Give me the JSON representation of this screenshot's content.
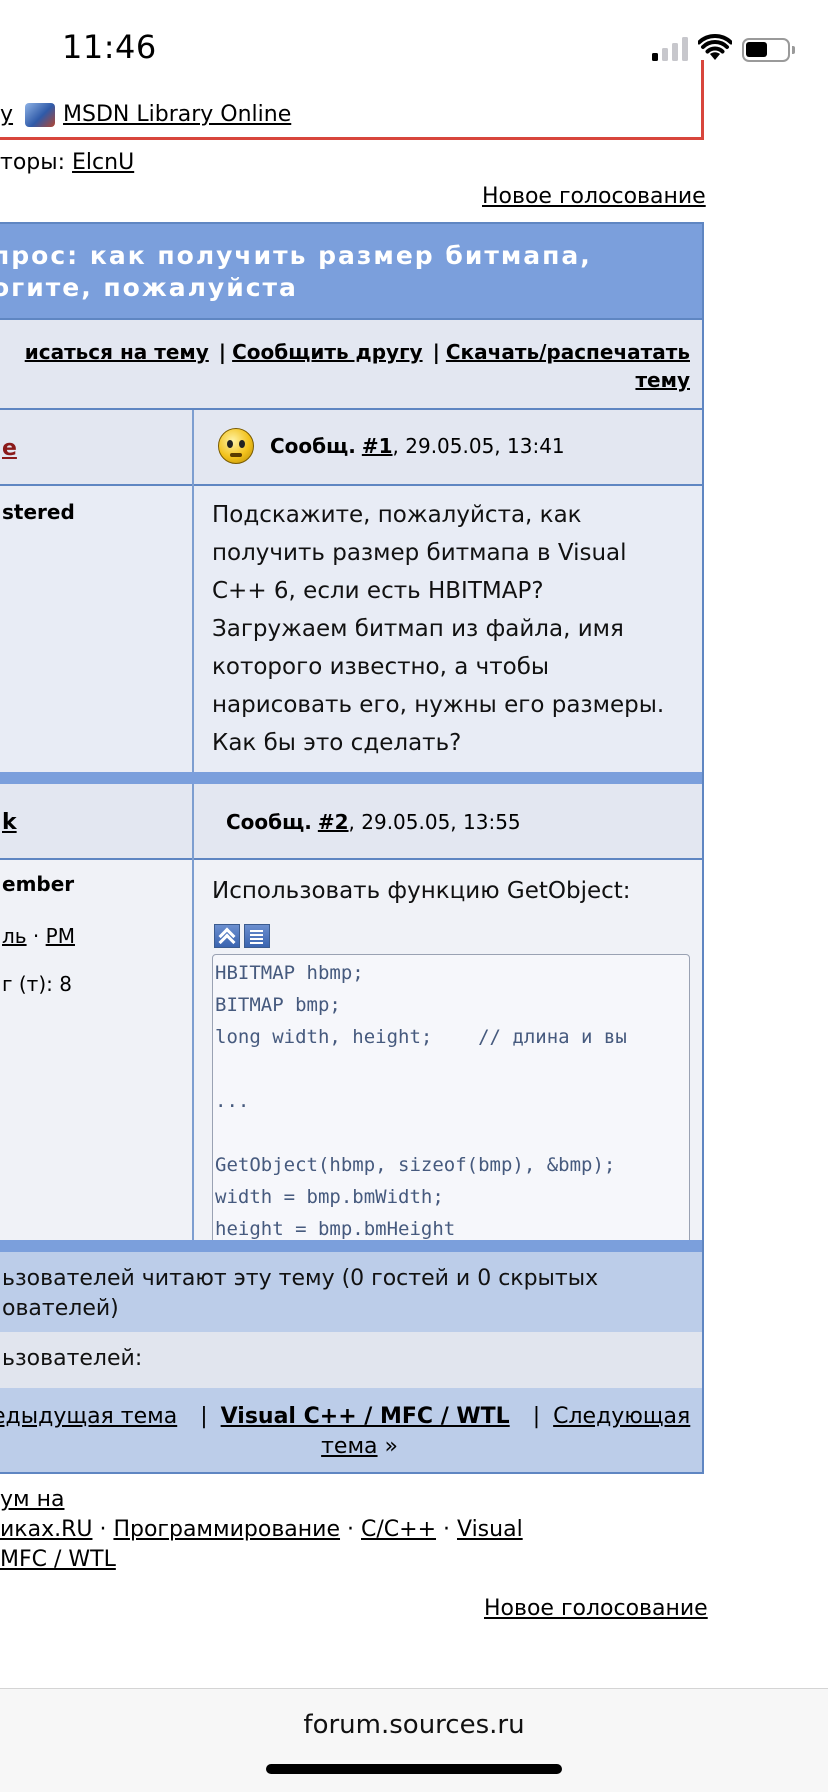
{
  "status_bar": {
    "time": "11:46"
  },
  "top": {
    "msdn_prefix": "у",
    "msdn_link": "MSDN Library Online",
    "moderators_label": "торы:",
    "moderator_name": "ElcnU",
    "new_poll": "Новое голосование"
  },
  "topic": {
    "title_line1": "прос: как получить размер битмапа,",
    "title_line2": "огите, пожалуйста",
    "options": {
      "subscribe": "исаться на тему",
      "tell_friend": "Сообщить другу",
      "download_line1": "Скачать/распечатать",
      "download_line2": "тему"
    }
  },
  "posts": [
    {
      "author": "e",
      "rank": "stered",
      "msg_label": "Сообщ.",
      "msg_num": "#1",
      "msg_date": ", 29.05.05, 13:41",
      "body_lines": [
        "Подскажите, пожалуйста, как",
        "получить размер битмапа в Visual",
        "C++ 6, если есть HBITMAP?",
        "Загружаем битмап из файла, имя",
        "которого известно, а чтобы",
        "нарисовать его, нужны его размеры.",
        "Как бы это сделать?"
      ]
    },
    {
      "author": "k",
      "rank": "ember",
      "profile_link": "ль",
      "pm_link": "PM",
      "reputation": "г (т): 8",
      "msg_label": "Сообщ.",
      "msg_num": "#2",
      "msg_date": ", 29.05.05, 13:55",
      "body_intro": "Использовать функцию GetObject:",
      "code_lines": [
        "HBITMAP hbmp;",
        "BITMAP bmp;",
        "long width, height;    // длина и вы",
        "",
        "...",
        "",
        "GetObject(hbmp, sizeof(bmp), &bmp);",
        "width = bmp.bmWidth;",
        "height = bmp.bmHeight"
      ]
    }
  ],
  "footer": {
    "readers_line1": "ьзователей читают эту тему (0 гостей и 0 скрытых",
    "readers_line2": "ователей)",
    "users_label": "ьзователей:",
    "prev_topic": "едыдущая тема",
    "forum_name": "Visual C++ / MFC / WTL",
    "next_topic_line1": "Следующая",
    "next_topic_line2": "тема",
    "next_arrow": " »",
    "breadcrumb_line1": "ум на",
    "breadcrumb_1": "иках.RU",
    "breadcrumb_2": "Программирование",
    "breadcrumb_3": "C/C++",
    "breadcrumb_4": "Visual",
    "breadcrumb_5": "MFC / WTL",
    "new_poll": "Новое голосование"
  },
  "browser": {
    "url": "forum.sources.ru"
  }
}
